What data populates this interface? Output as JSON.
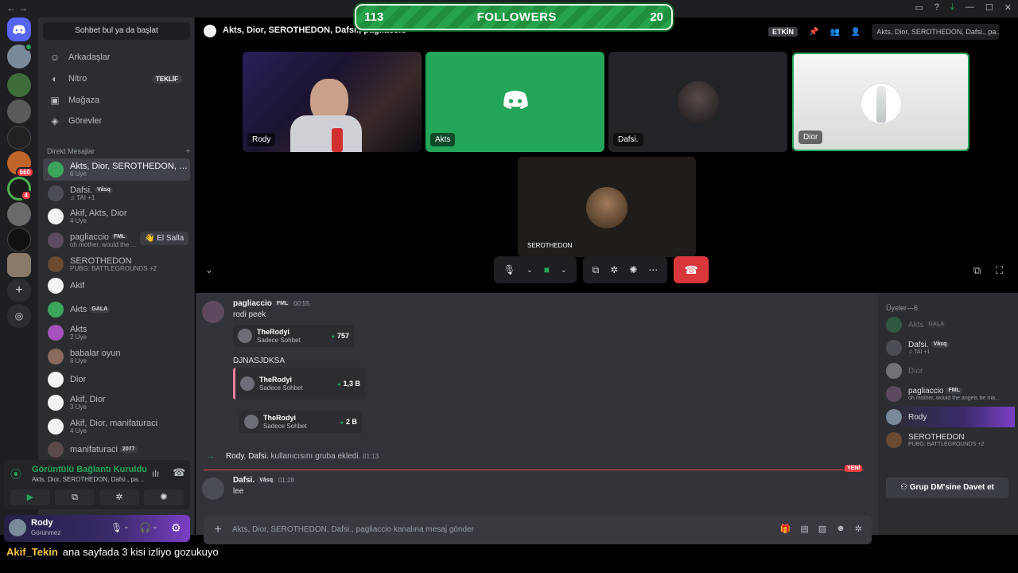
{
  "window": {
    "nav_arrows": "← →",
    "controls": [
      "▭",
      "?",
      "⤓",
      "—",
      "☐",
      "✕"
    ]
  },
  "overlay": {
    "followers_current": "113",
    "followers_label": "FOLLOWERS",
    "followers_goal": "20"
  },
  "dm_sidebar": {
    "search_placeholder": "Sohbet bul ya da başlat",
    "nav": [
      {
        "label": "Arkadaşlar",
        "icon": "friends-icon"
      },
      {
        "label": "Nitro",
        "icon": "nitro-icon",
        "pill": "TEKLİF"
      },
      {
        "label": "Mağaza",
        "icon": "shop-icon"
      },
      {
        "label": "Görevler",
        "icon": "quests-icon"
      }
    ],
    "dm_header": "Direkt Mesajlar",
    "dm_add": "+",
    "dms": [
      {
        "name": "Akts, Dior, SEROTHEDON, Dafsi., ...",
        "sub": "6 Üye",
        "color": "#3ba55c",
        "active": true
      },
      {
        "name": "Dafsi.",
        "tag": "Våsq",
        "sub": "♫ TAI +1",
        "color": "#4b4d55"
      },
      {
        "name": "Akif, Akts, Dior",
        "sub": "4 Üye",
        "color": "#f2f3f5"
      },
      {
        "name": "pagliaccio",
        "tag": "FML",
        "sub": "oh mother, would the ...",
        "color": "#5c4a5e"
      },
      {
        "name": "SEROTHEDON",
        "sub": "PUBG: BATTLEGROUNDS +2",
        "color": "#6b4a32"
      },
      {
        "name": "Akif",
        "sub": "",
        "color": "#f2f3f5"
      },
      {
        "name": "Akts",
        "tag": "GALA",
        "sub": "",
        "color": "#3ba55c"
      },
      {
        "name": "Akts",
        "sub": "2 Üye",
        "color": "#a652bb"
      },
      {
        "name": "babalar oyun",
        "sub": "6 Üye",
        "color": "#8a6a5a"
      },
      {
        "name": "Dior",
        "sub": "",
        "color": "#f2f3f5"
      },
      {
        "name": "Akif, Dior",
        "sub": "3 Üye",
        "color": "#f2f3f5"
      },
      {
        "name": "Akif, Dior, manifaturaci",
        "sub": "4 Üye",
        "color": "#f2f3f5"
      },
      {
        "name": "manifaturaci",
        "tag": "2077",
        "sub": "",
        "color": "#5a4a4a"
      }
    ],
    "wave_button": "👋 El Salla"
  },
  "voice_panel": {
    "title": "Görüntülü Bağlantı Kuruldu",
    "subtitle": "Akts, Dior, SEROTHEDON, Dafsi., pagliaccio...",
    "buttons": [
      "▶",
      "⧉",
      "✲",
      "✺"
    ]
  },
  "user_panel": {
    "name": "Rody",
    "status": "Görünmez"
  },
  "channel": {
    "title": "Akts, Dior, SEROTHEDON, Dafsi., pagliaccio",
    "etkin": "ETKİN",
    "search": "Akts, Dior, SEROTHEDON, Dafsi., pa..."
  },
  "tiles": [
    {
      "label": "Rody",
      "kind": "webcam"
    },
    {
      "label": "Akts",
      "kind": "discord"
    },
    {
      "label": "Dafsi.",
      "kind": "avatar"
    },
    {
      "label": "Dior",
      "kind": "bottle"
    },
    {
      "label": "SEROTHEDON",
      "kind": "avatar2"
    }
  ],
  "messages": [
    {
      "author": "pagliaccio",
      "tag": "FML",
      "time": "00:55",
      "text": "rodi peek"
    },
    {
      "author": "",
      "tag": "",
      "time": "",
      "text": "DJNASJDKSA"
    },
    {
      "author": "Dafsi.",
      "tag": "Våsq",
      "time": "01:28",
      "text": "lee"
    }
  ],
  "embeds": [
    {
      "name": "TheRodyi",
      "sub": "Sadece Sohbet",
      "value": "757"
    },
    {
      "name": "TheRodyi",
      "sub": "Sadece Sohbet",
      "value": "1,3 B"
    },
    {
      "name": "TheRodyi",
      "sub": "Sadece Sohbet",
      "value": "2 B"
    }
  ],
  "system_message": {
    "who": "Rody",
    "target": "Dafsi.",
    "text": " kullanıcısını gruba ekledi.",
    "time": "01:13"
  },
  "new_label": "YENİ",
  "composer_placeholder": "Akts, Dior, SEROTHEDON, Dafsi., pagliaccio kanalına mesaj gönder",
  "members": {
    "header": "Üyeler—6",
    "list": [
      {
        "name": "Akts",
        "tag": "GALA",
        "sub": "",
        "color": "#3ba55c",
        "dim": true
      },
      {
        "name": "Dafsi.",
        "tag": "Våsq",
        "sub": "♫ TAI +1",
        "color": "#4b4d55",
        "dim": false
      },
      {
        "name": "Dior",
        "tag": "",
        "sub": "",
        "color": "#f2f3f5",
        "dim": true
      },
      {
        "name": "pagliaccio",
        "tag": "FML",
        "sub": "oh mother, would the angels be ma...",
        "color": "#5c4a5e",
        "dim": false
      },
      {
        "name": "Rody",
        "tag": "",
        "sub": "",
        "color": "#7a8a9a",
        "dim": false
      },
      {
        "name": "SEROTHEDON",
        "tag": "",
        "sub": "PUBG: BATTLEGROUNDS +2",
        "color": "#6b4a32",
        "dim": false
      }
    ],
    "invite": "Grup DM'sine Davet et"
  },
  "stream_caption": {
    "user": "Akif_Tekin",
    "text": "ana sayfada 3 kisi izliyo gozukuyo"
  },
  "colors": {
    "accent_green": "#23a55a",
    "danger": "#da373c",
    "blurple": "#5865f2"
  }
}
